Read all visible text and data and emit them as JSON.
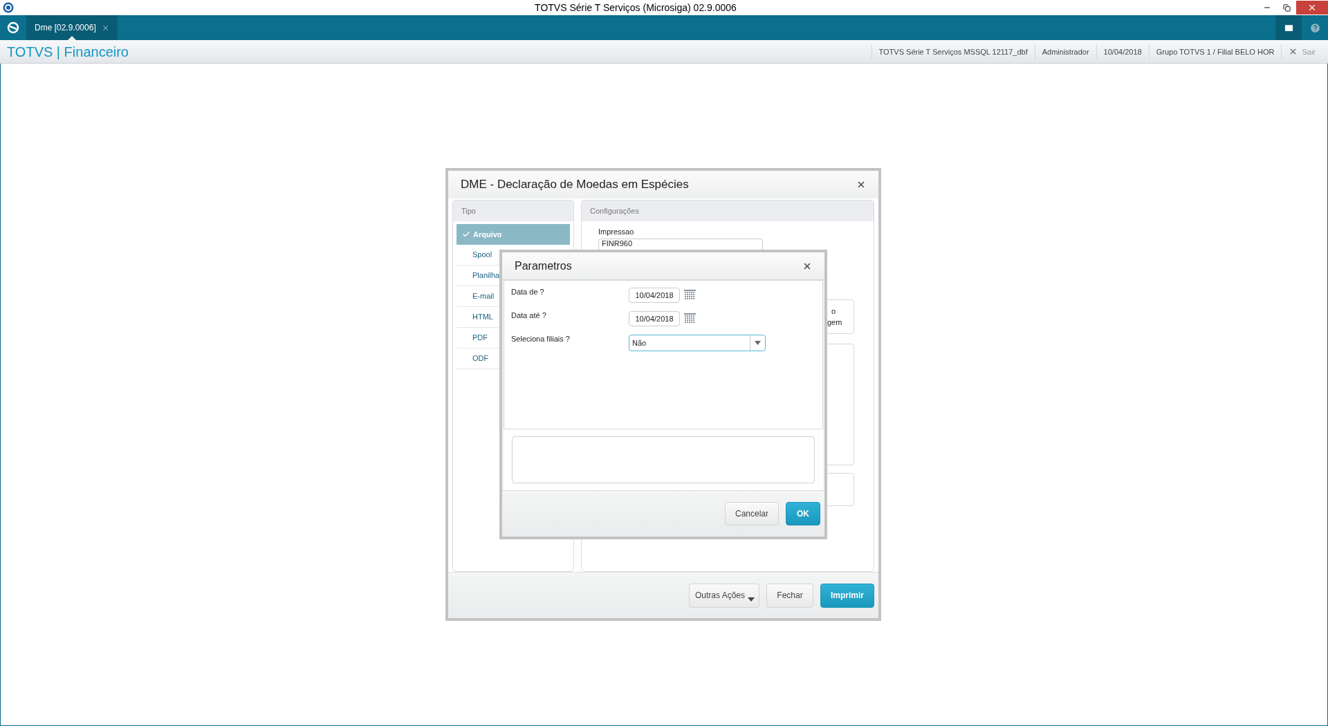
{
  "window": {
    "title": "TOTVS Série T Serviços (Microsiga) 02.9.0006"
  },
  "tabs": [
    {
      "label": "Dme [02.9.0006]",
      "selected": true
    }
  ],
  "header": {
    "brand": "TOTVS | Financeiro",
    "info": [
      "TOTVS Série T Serviços MSSQL 12117_dbf",
      "Administrador",
      "10/04/2018",
      "Grupo TOTVS 1 / Filial BELO HOR"
    ],
    "logout": {
      "label": "Sair",
      "disabled": true
    }
  },
  "dialog": {
    "title": "DME - Declaração de Moedas em Espécies",
    "tipo": {
      "title": "Tipo",
      "items": [
        {
          "label": "Arquivo",
          "selected": true
        },
        {
          "label": "Spool",
          "selected": false
        },
        {
          "label": "Planilha",
          "selected": false
        },
        {
          "label": "E-mail",
          "selected": false
        },
        {
          "label": "HTML",
          "selected": false
        },
        {
          "label": "PDF",
          "selected": false
        },
        {
          "label": "ODF",
          "selected": false
        }
      ]
    },
    "config": {
      "title": "Configurações",
      "impressao_label": "Impressao",
      "impressao_value": "FINR960",
      "fragments": [
        "o",
        "gem"
      ]
    },
    "buttons": [
      {
        "label": "Outras Ações",
        "kind": "menu"
      },
      {
        "label": "Fechar",
        "kind": "default"
      },
      {
        "label": "Imprimir",
        "kind": "primary"
      }
    ]
  },
  "params": {
    "title": "Parametros",
    "fields": [
      {
        "label": "Data de ?",
        "kind": "date",
        "value": "10/04/2018"
      },
      {
        "label": "Data até ?",
        "kind": "date",
        "value": "10/04/2018"
      },
      {
        "label": "Seleciona filiais ?",
        "kind": "select",
        "value": "Não"
      }
    ],
    "buttons": [
      {
        "label": "Cancelar",
        "kind": "default"
      },
      {
        "label": "OK",
        "kind": "primary"
      }
    ]
  }
}
